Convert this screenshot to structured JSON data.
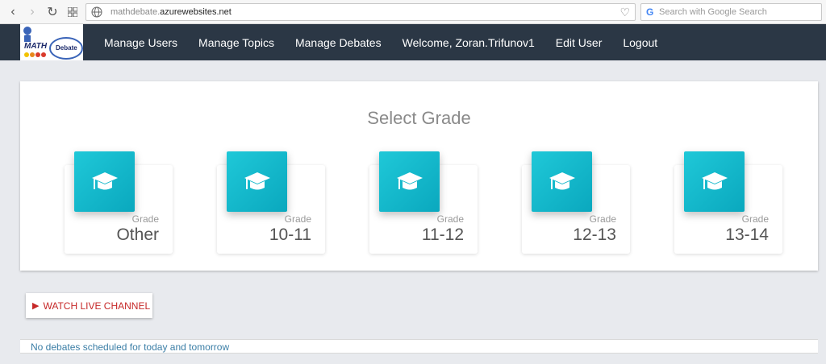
{
  "browser": {
    "url_prefix": "mathdebate.",
    "url_domain": "azurewebsites.net",
    "search_placeholder": "Search with Google Search"
  },
  "logo": {
    "text_math": "MATH",
    "text_debate": "Debate"
  },
  "nav": {
    "items": [
      {
        "label": "Manage Users"
      },
      {
        "label": "Manage Topics"
      },
      {
        "label": "Manage Debates"
      },
      {
        "label": "Welcome, Zoran.Trifunov1"
      },
      {
        "label": "Edit User"
      },
      {
        "label": "Logout"
      }
    ]
  },
  "main": {
    "title": "Select Grade",
    "grade_label": "Grade",
    "grades": [
      {
        "value": "Other"
      },
      {
        "value": "10-11"
      },
      {
        "value": "11-12"
      },
      {
        "value": "12-13"
      },
      {
        "value": "13-14"
      }
    ]
  },
  "watch": {
    "label": "WATCH LIVE CHANNEL"
  },
  "footer": {
    "message": "No debates scheduled for today and tomorrow"
  },
  "colors": {
    "navbar": "#2b3745",
    "accent": "#12b8cc",
    "watch": "#c62828",
    "footer_text": "#3b7ea6"
  }
}
